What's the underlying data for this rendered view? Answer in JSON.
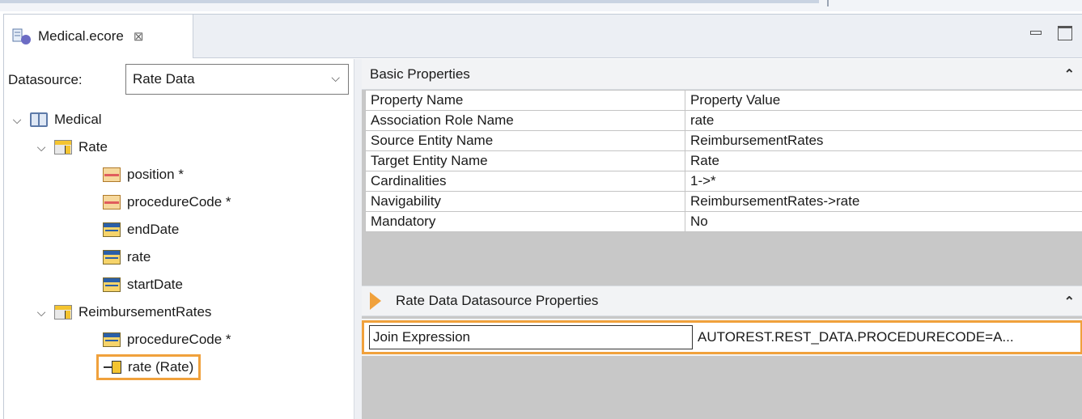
{
  "tab": {
    "label": "Medical.ecore",
    "close": "⊠"
  },
  "datasource": {
    "label": "Datasource:",
    "value": "Rate Data"
  },
  "tree": {
    "root": "Medical",
    "rate_entity": "Rate",
    "rate_children": [
      "position *",
      "procedureCode *",
      "endDate",
      "rate",
      "startDate"
    ],
    "reimb_entity": "ReimbursementRates",
    "reimb_children": [
      "procedureCode *",
      "rate (Rate)"
    ]
  },
  "basic": {
    "title": "Basic Properties",
    "headers": [
      "Property Name",
      "Property Value"
    ],
    "rows": [
      [
        "Association Role Name",
        "rate"
      ],
      [
        "Source Entity Name",
        "ReimbursementRates"
      ],
      [
        "Target Entity Name",
        "Rate"
      ],
      [
        "Cardinalities",
        "1->*"
      ],
      [
        "Navigability",
        "ReimbursementRates->rate"
      ],
      [
        "Mandatory",
        "No"
      ]
    ]
  },
  "ds_props": {
    "title": "Rate Data Datasource Properties",
    "join_name": "Join Expression",
    "join_value": "AUTOREST.REST_DATA.PROCEDURECODE=A..."
  },
  "colors": {
    "highlight": "#f0a13c",
    "section_bg": "#f2f3f5",
    "empty_area": "#c8c8c8"
  }
}
